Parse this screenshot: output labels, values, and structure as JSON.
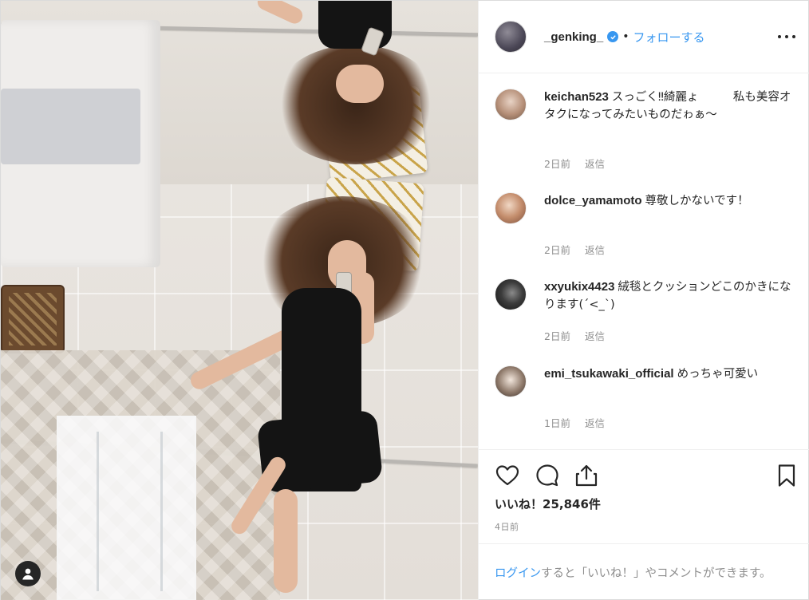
{
  "header": {
    "username": "_genking_",
    "separator": "•",
    "follow_label": "フォローする"
  },
  "comments": [
    {
      "username": "keichan523",
      "text": "スっごく‼綺麗ょ   私も美容オタクになってみたいものだゎぁ〜",
      "age": "2日前",
      "reply_label": "返信"
    },
    {
      "username": "dolce_yamamoto",
      "text": "尊敬しかないです！",
      "age": "2日前",
      "reply_label": "返信"
    },
    {
      "username": "xxyukix4423",
      "text": "絨毯とクッションどこのかきになります(´<_`)",
      "age": "2日前",
      "reply_label": "返信"
    },
    {
      "username": "emi_tsukawaki_official",
      "text": "めっちゃ可愛い",
      "age": "1日前",
      "reply_label": "返信"
    }
  ],
  "likes": {
    "label": "いいね！",
    "count": "25,846件"
  },
  "post_age": "4日前",
  "login_prompt": {
    "link_text": "ログイン",
    "rest_text": "すると「いいね！」やコメントができます。"
  },
  "colors": {
    "accent": "#3897f0",
    "text": "#262626",
    "muted": "#8e8e8e",
    "border": "#efefef"
  }
}
